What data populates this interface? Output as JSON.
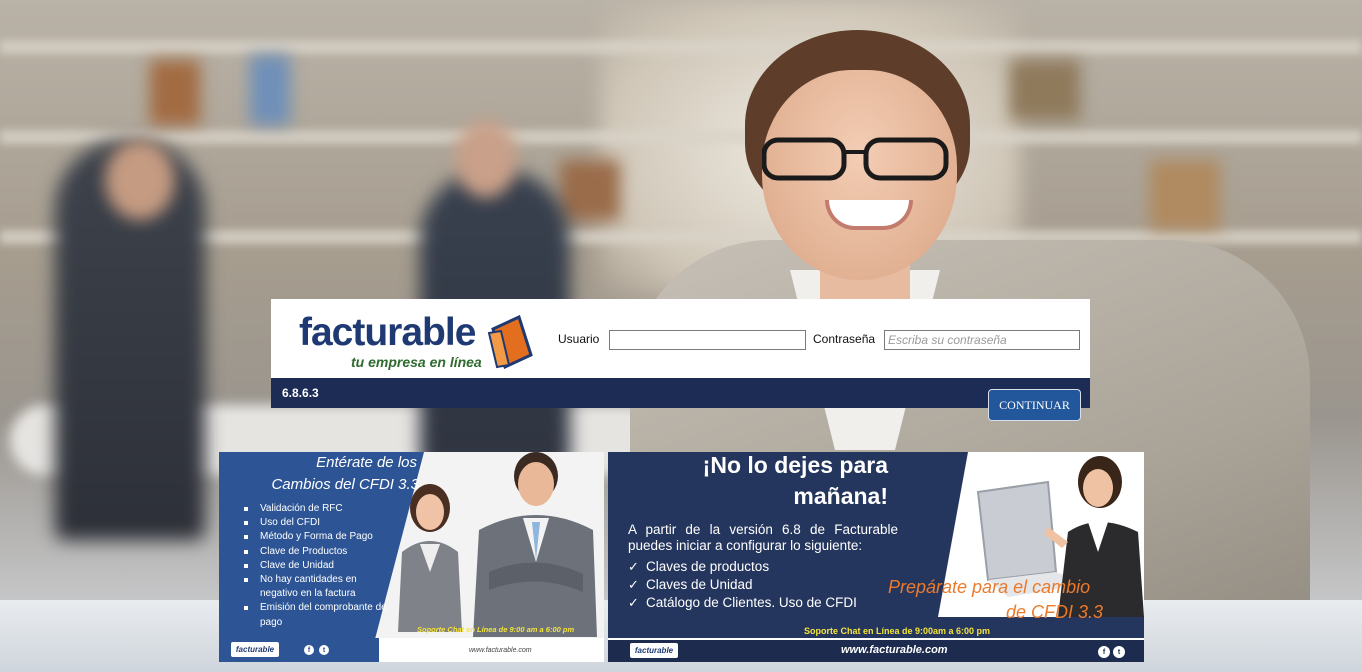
{
  "login": {
    "logo_word": "facturable",
    "logo_tagline": "tu empresa en línea",
    "usuario_label": "Usuario",
    "usuario_value": "",
    "password_label": "Contraseña",
    "password_placeholder": "Escriba su contraseña",
    "version": "6.8.6.3",
    "continue_label": "CONTINUAR"
  },
  "banner_left": {
    "title_line1": "Entérate de los",
    "title_line2": "Cambios del CFDI 3.3",
    "items": [
      "Validación de RFC",
      "Uso del CFDI",
      "Método y Forma de Pago",
      "Clave de Productos",
      "Clave de Unidad",
      "No hay cantidades en negativo en la factura",
      "Emisión del comprobante de pago"
    ],
    "support": "Soporte Chat en Línea de 9:00 am a 6:00 pm",
    "website": "www.facturable.com",
    "mini_logo": "facturable"
  },
  "banner_right": {
    "title_line1": "¡No lo dejes para",
    "title_line2": "mañana!",
    "paragraph": "A partir de la versión 6.8 de Facturable puedes iniciar a configurar lo siguiente:",
    "items": [
      "Claves de productos",
      "Claves de Unidad",
      "Catálogo de Clientes. Uso de CFDI"
    ],
    "prepare_line1": "Prepárate para el cambio",
    "prepare_line2": "de CFDI 3.3",
    "support": "Soporte Chat en Línea de 9:00am a 6:00 pm",
    "website": "www.facturable.com",
    "mini_logo": "facturable"
  },
  "icons": {
    "facebook": "facebook-icon",
    "twitter": "twitter-icon"
  },
  "colors": {
    "navy_bar": "#1d2c55",
    "button": "#23579b",
    "banner_blue": "#2d5596",
    "banner_dark": "#25365e",
    "accent_orange": "#ec7a2b",
    "support_yellow": "#f5e43b"
  }
}
